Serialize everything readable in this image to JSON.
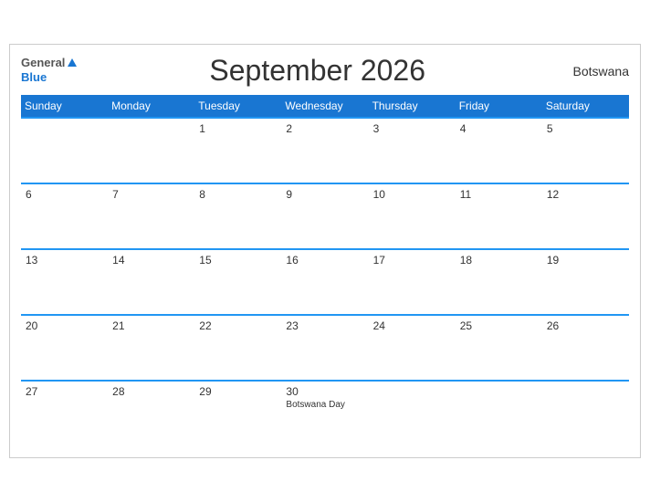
{
  "header": {
    "logo_general": "General",
    "logo_blue": "Blue",
    "title": "September 2026",
    "country": "Botswana"
  },
  "weekdays": [
    "Sunday",
    "Monday",
    "Tuesday",
    "Wednesday",
    "Thursday",
    "Friday",
    "Saturday"
  ],
  "weeks": [
    [
      {
        "day": "",
        "holiday": ""
      },
      {
        "day": "",
        "holiday": ""
      },
      {
        "day": "1",
        "holiday": ""
      },
      {
        "day": "2",
        "holiday": ""
      },
      {
        "day": "3",
        "holiday": ""
      },
      {
        "day": "4",
        "holiday": ""
      },
      {
        "day": "5",
        "holiday": ""
      }
    ],
    [
      {
        "day": "6",
        "holiday": ""
      },
      {
        "day": "7",
        "holiday": ""
      },
      {
        "day": "8",
        "holiday": ""
      },
      {
        "day": "9",
        "holiday": ""
      },
      {
        "day": "10",
        "holiday": ""
      },
      {
        "day": "11",
        "holiday": ""
      },
      {
        "day": "12",
        "holiday": ""
      }
    ],
    [
      {
        "day": "13",
        "holiday": ""
      },
      {
        "day": "14",
        "holiday": ""
      },
      {
        "day": "15",
        "holiday": ""
      },
      {
        "day": "16",
        "holiday": ""
      },
      {
        "day": "17",
        "holiday": ""
      },
      {
        "day": "18",
        "holiday": ""
      },
      {
        "day": "19",
        "holiday": ""
      }
    ],
    [
      {
        "day": "20",
        "holiday": ""
      },
      {
        "day": "21",
        "holiday": ""
      },
      {
        "day": "22",
        "holiday": ""
      },
      {
        "day": "23",
        "holiday": ""
      },
      {
        "day": "24",
        "holiday": ""
      },
      {
        "day": "25",
        "holiday": ""
      },
      {
        "day": "26",
        "holiday": ""
      }
    ],
    [
      {
        "day": "27",
        "holiday": ""
      },
      {
        "day": "28",
        "holiday": ""
      },
      {
        "day": "29",
        "holiday": ""
      },
      {
        "day": "30",
        "holiday": "Botswana Day"
      },
      {
        "day": "",
        "holiday": ""
      },
      {
        "day": "",
        "holiday": ""
      },
      {
        "day": "",
        "holiday": ""
      }
    ]
  ],
  "colors": {
    "header_bg": "#1976D2",
    "row_border": "#2196F3",
    "accent": "#2196F3"
  }
}
